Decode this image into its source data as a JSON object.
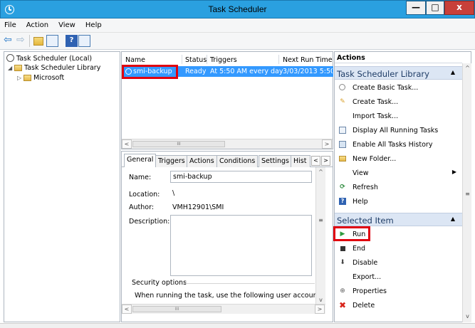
{
  "window": {
    "title": "Task Scheduler"
  },
  "window_buttons": {
    "minimize": "—",
    "maximize": "□",
    "close": "x"
  },
  "menu": [
    "File",
    "Action",
    "View",
    "Help"
  ],
  "toolbar": {
    "back": "⇦",
    "forward": "⇨",
    "help": "?"
  },
  "tree": {
    "root": "Task Scheduler (Local)",
    "library": "Task Scheduler Library",
    "child": "Microsoft"
  },
  "task_list": {
    "columns": [
      "Name",
      "Status",
      "Triggers",
      "Next Run Time"
    ],
    "rows": [
      {
        "name": "smi-backup",
        "status": "Ready",
        "triggers": "At 5:50 AM every day",
        "next_run": "3/03/2013 5:50"
      }
    ],
    "scroll_thumb": "III"
  },
  "details": {
    "tabs": [
      "General",
      "Triggers",
      "Actions",
      "Conditions",
      "Settings",
      "Hist"
    ],
    "active_tab": "General",
    "labels": {
      "name": "Name:",
      "location": "Location:",
      "author": "Author:",
      "description": "Description:"
    },
    "values": {
      "name": "smi-backup",
      "location": "\\",
      "author": "VMH12901\\SMI",
      "description": ""
    },
    "security_options": "Security options",
    "security_text": "When running the task, use the following user account:",
    "scroll_thumb": "III"
  },
  "actions": {
    "header": "Actions",
    "section1": "Task Scheduler Library",
    "items1": [
      {
        "label": "Create Basic Task...",
        "icon": "create-basic-task-icon"
      },
      {
        "label": "Create Task...",
        "icon": "create-task-icon"
      },
      {
        "label": "Import Task...",
        "icon": ""
      },
      {
        "label": "Display All Running Tasks",
        "icon": "running-tasks-icon"
      },
      {
        "label": "Enable All Tasks History",
        "icon": "history-icon"
      },
      {
        "label": "New Folder...",
        "icon": "new-folder-icon"
      },
      {
        "label": "View",
        "icon": ""
      },
      {
        "label": "Refresh",
        "icon": "refresh-icon"
      },
      {
        "label": "Help",
        "icon": "help-icon"
      }
    ],
    "section2": "Selected Item",
    "items2": [
      {
        "label": "Run",
        "icon": "run-icon"
      },
      {
        "label": "End",
        "icon": "end-icon"
      },
      {
        "label": "Disable",
        "icon": "disable-icon"
      },
      {
        "label": "Export...",
        "icon": ""
      },
      {
        "label": "Properties",
        "icon": "properties-icon"
      },
      {
        "label": "Delete",
        "icon": "delete-icon"
      }
    ]
  },
  "colors": {
    "titlebar": "#2aa0e0",
    "selection": "#3399ff",
    "highlight_box": "#e0000f",
    "section_bg": "#dce6f4"
  }
}
